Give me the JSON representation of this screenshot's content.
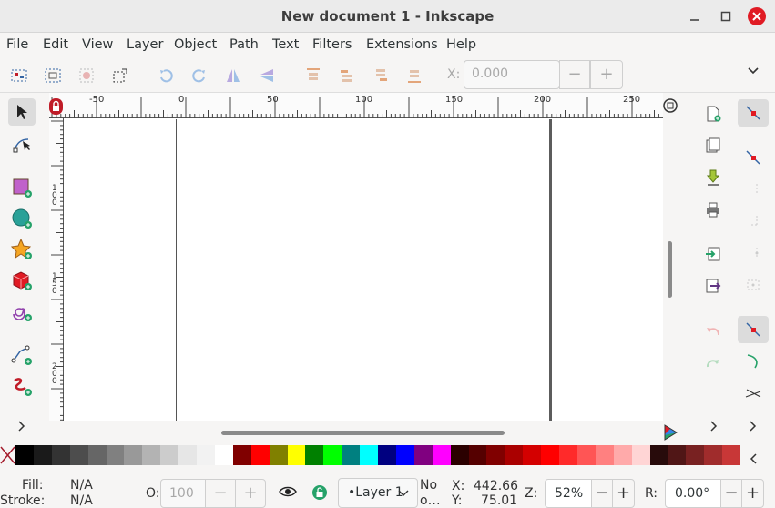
{
  "window": {
    "title": "New document 1 - Inkscape"
  },
  "menu": [
    "File",
    "Edit",
    "View",
    "Layer",
    "Object",
    "Path",
    "Text",
    "Filters",
    "Extensions",
    "Help"
  ],
  "command_bar": {
    "x_label": "X:",
    "x_value": "0.000",
    "minus": "−",
    "plus": "+",
    "expand": "⌄"
  },
  "ruler": {
    "h_labels": [
      "-50",
      "0",
      "50",
      "100",
      "150",
      "200",
      "250"
    ],
    "v_labels": [
      "1",
      "0",
      "0",
      "1",
      "5",
      "0",
      "2",
      "0",
      "0"
    ]
  },
  "palette_colors": [
    "#000000",
    "#1a1a1a",
    "#333333",
    "#4d4d4d",
    "#666666",
    "#808080",
    "#999999",
    "#b3b3b3",
    "#cccccc",
    "#e6e6e6",
    "#f2f2f2",
    "#ffffff",
    "#800000",
    "#ff0000",
    "#808000",
    "#ffff00",
    "#008000",
    "#00ff00",
    "#008080",
    "#00ffff",
    "#000080",
    "#0000ff",
    "#800080",
    "#ff00ff",
    "#2b0000",
    "#550000",
    "#800000",
    "#aa0000",
    "#d40000",
    "#ff0000",
    "#ff2a2a",
    "#ff5555",
    "#ff8080",
    "#ffaaaa",
    "#ffd5d5",
    "#280b0b",
    "#501616",
    "#782121",
    "#a02c2c",
    "#c83737"
  ],
  "status": {
    "fill_label": "Fill:",
    "fill_value": "N/A",
    "stroke_label": "Stroke:",
    "stroke_value": "N/A",
    "opacity_label": "O:",
    "opacity_value": "100",
    "layer": "•Layer 1",
    "no_obj_line1": "No",
    "no_obj_line2": "o…",
    "x_label": "X:",
    "x_value": "442.66",
    "y_label": "Y:",
    "y_value": "75.01",
    "zoom_label": "Z:",
    "zoom_value": "52%",
    "rot_label": "R:",
    "rot_value": "0.00°",
    "minus": "−",
    "plus": "+"
  },
  "colors": {
    "accent_green": "#26a269",
    "close_red": "#e01b24",
    "guide": "#5c5c5c"
  }
}
